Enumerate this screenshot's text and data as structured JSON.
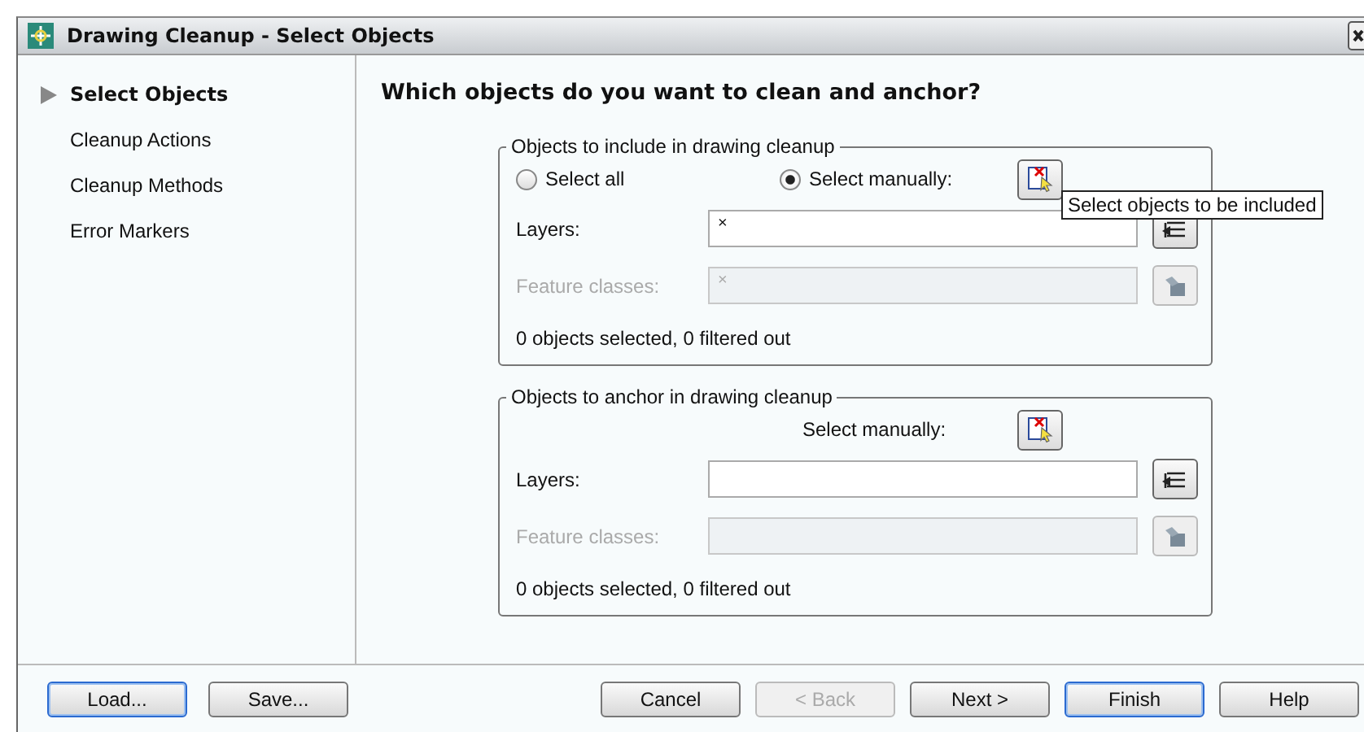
{
  "window": {
    "title": "Drawing Cleanup - Select Objects"
  },
  "sidebar": {
    "items": [
      {
        "label": "Select Objects",
        "selected": true
      },
      {
        "label": "Cleanup Actions",
        "selected": false
      },
      {
        "label": "Cleanup Methods",
        "selected": false
      },
      {
        "label": "Error Markers",
        "selected": false
      }
    ]
  },
  "heading": "Which objects do you want to clean and anchor?",
  "groups": [
    {
      "title": "Objects to include in drawing cleanup",
      "kind": "radios",
      "options": [
        {
          "label": "Select all",
          "selected": false
        },
        {
          "label": "Select manually:",
          "selected": true
        }
      ],
      "fields": [
        {
          "label": "Layers:",
          "value": "×",
          "disabled": false
        },
        {
          "label": "Feature classes:",
          "value": "×",
          "disabled": true
        }
      ],
      "status": "0 objects selected, 0 filtered out",
      "tooltip": "Select objects to be included"
    },
    {
      "title": "Objects to anchor in drawing cleanup",
      "kind": "label",
      "manual_label": "Select manually:",
      "fields": [
        {
          "label": "Layers:",
          "disabled": false
        },
        {
          "label": "Feature classes:",
          "disabled": true
        }
      ],
      "status": "0 objects selected, 0 filtered out"
    }
  ],
  "footer": {
    "left": [
      {
        "label": "Load...",
        "default": true,
        "disabled": false
      },
      {
        "label": "Save...",
        "default": false,
        "disabled": false
      }
    ],
    "right": [
      {
        "label": "Cancel",
        "default": false,
        "disabled": false
      },
      {
        "label": "< Back",
        "default": false,
        "disabled": true
      },
      {
        "label": "Next >",
        "default": false,
        "disabled": false
      },
      {
        "label": "Finish",
        "default": true,
        "disabled": false
      },
      {
        "label": "Help",
        "default": false,
        "disabled": false
      }
    ]
  }
}
